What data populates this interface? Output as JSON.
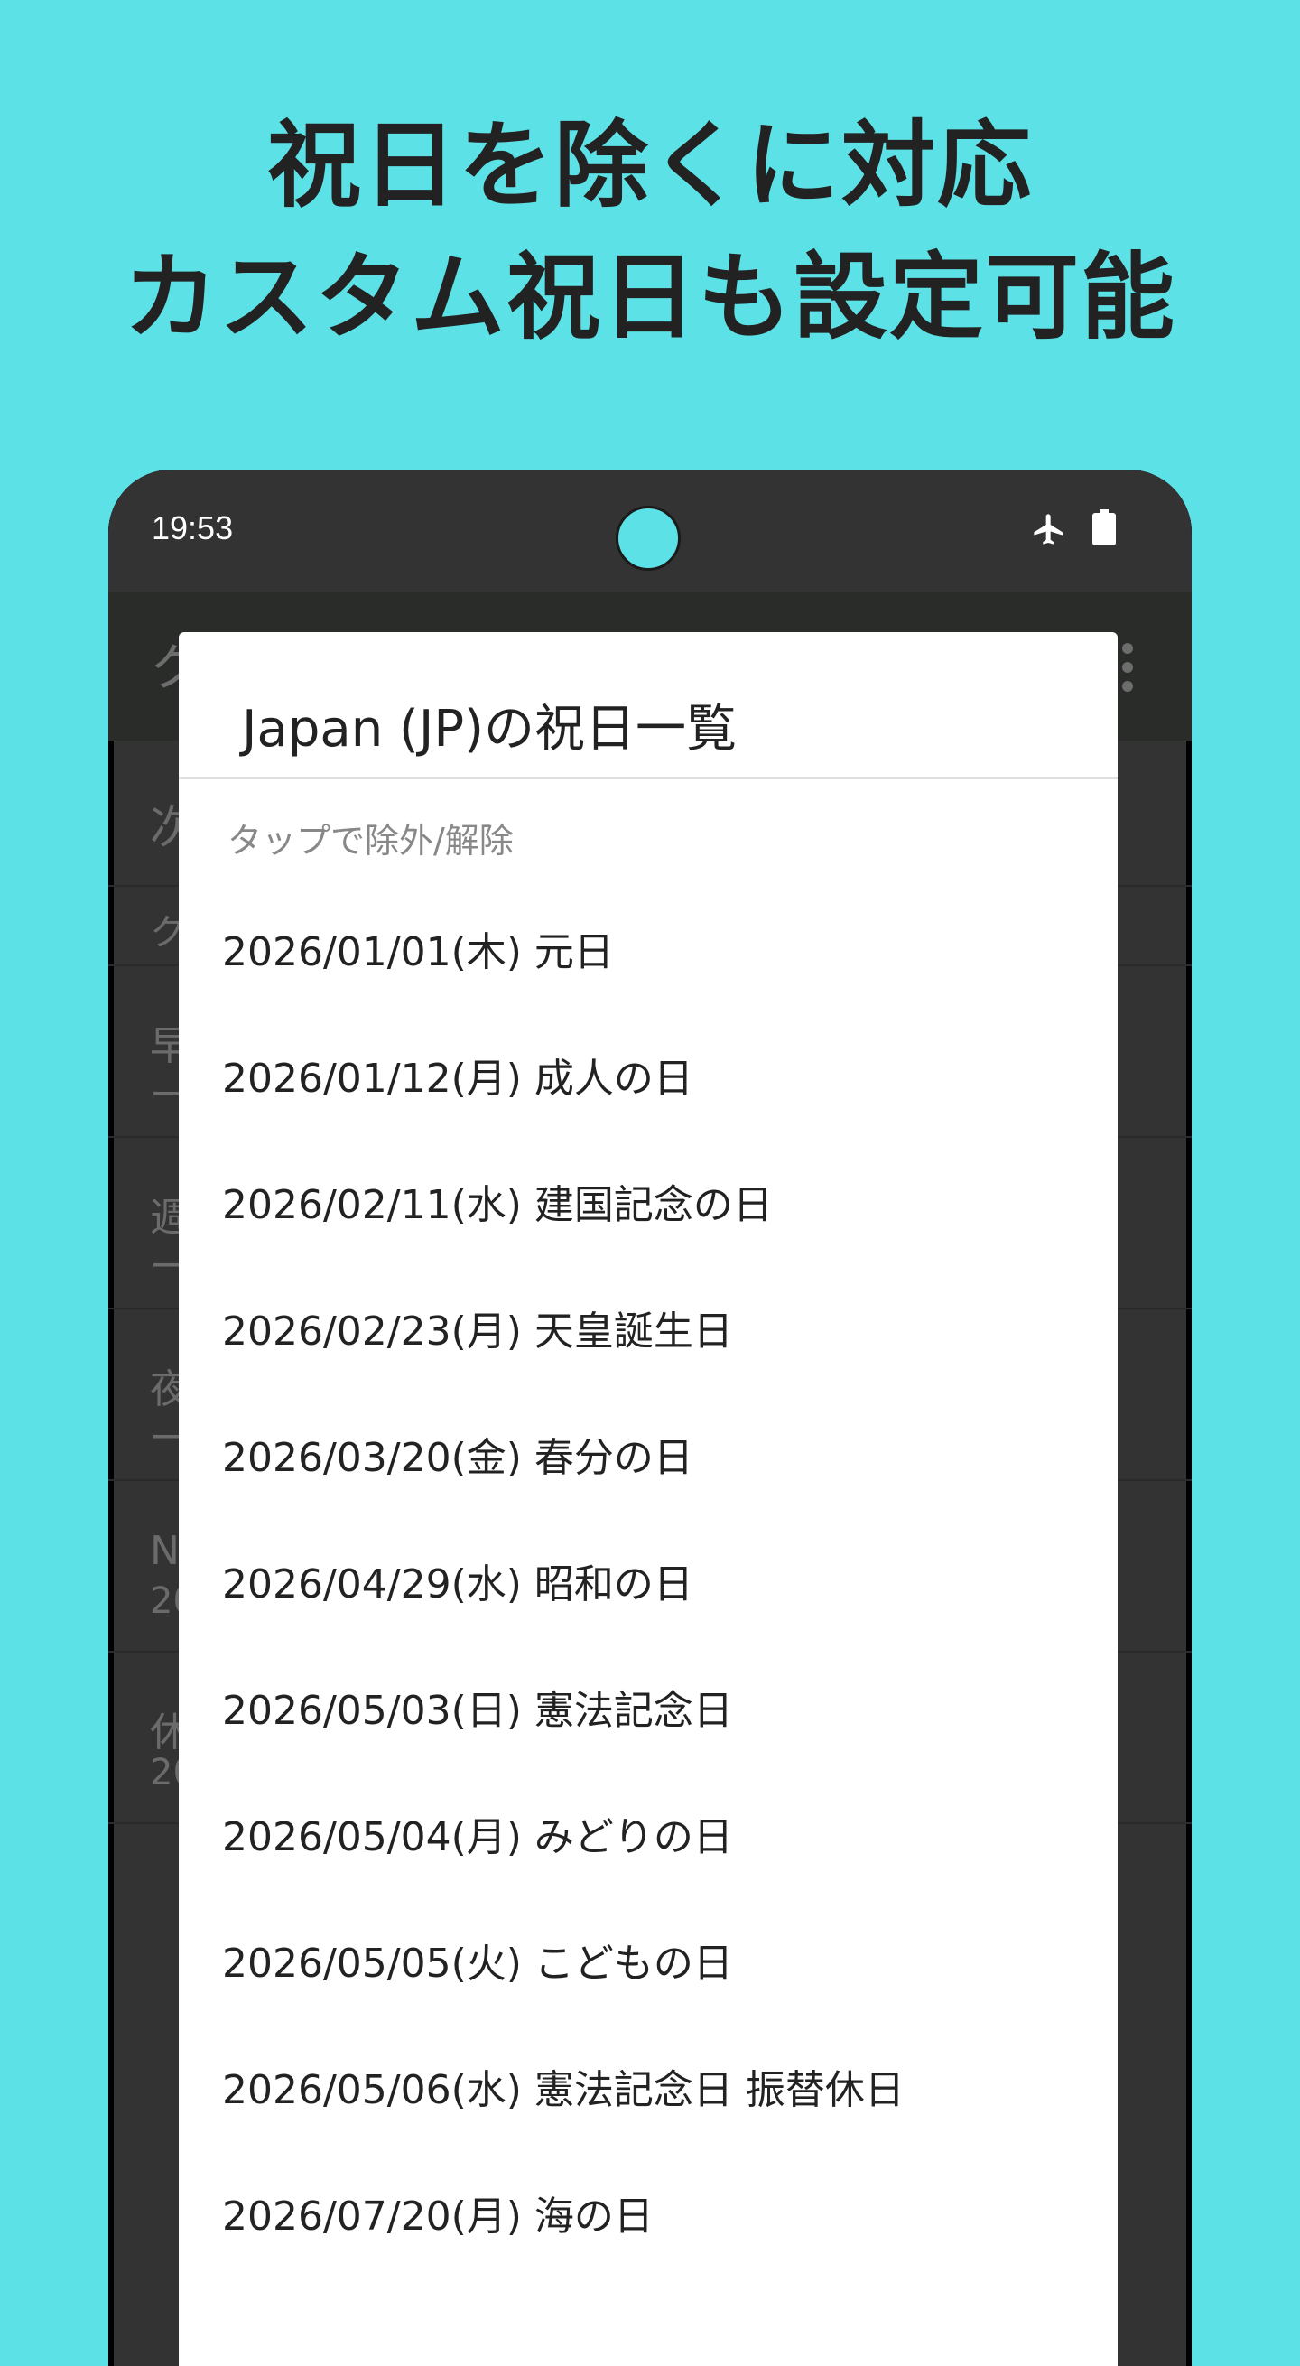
{
  "headline": {
    "line1": "祝日を除くに対応",
    "line2": "カスタム祝日も設定可能"
  },
  "status_bar": {
    "time": "19:53",
    "icons": [
      "airplane-icon",
      "battery-icon"
    ]
  },
  "app_bar": {
    "title_partial": "ク",
    "menu_icon": "overflow-menu-icon"
  },
  "background_list": {
    "first_row": "次",
    "section_header": "ク",
    "rows": [
      {
        "line1": "早",
        "line2": "ー"
      },
      {
        "line1": "週",
        "line2": "ー"
      },
      {
        "line1": "夜",
        "line2": "ー"
      },
      {
        "line1": "N",
        "line2": "20"
      },
      {
        "line1": "休",
        "line2": "20"
      }
    ]
  },
  "dialog": {
    "title": "Japan (JP)の祝日一覧",
    "hint": "タップで除外/解除",
    "holidays": [
      "2026/01/01(木) 元日",
      "2026/01/12(月) 成人の日",
      "2026/02/11(水) 建国記念の日",
      "2026/02/23(月) 天皇誕生日",
      "2026/03/20(金) 春分の日",
      "2026/04/29(水) 昭和の日",
      "2026/05/03(日) 憲法記念日",
      "2026/05/04(月) みどりの日",
      "2026/05/05(火) こどもの日",
      "2026/05/06(水) 憲法記念日 振替休日",
      "2026/07/20(月) 海の日"
    ]
  },
  "colors": {
    "background": "#5ce1e6",
    "phone_frame": "#333333",
    "dialog": "#ffffff",
    "headline_text": "#222222"
  }
}
